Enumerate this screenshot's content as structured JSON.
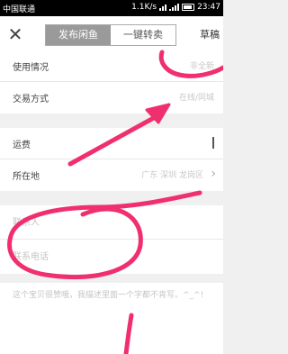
{
  "status_bar": {
    "carrier": "中国联通",
    "network_speed": "1.1K/s",
    "time": "23:47"
  },
  "toolbar": {
    "close_icon": "close-icon",
    "tabs": [
      {
        "label": "发布闲鱼",
        "active": true
      },
      {
        "label": "一键转卖",
        "active": false
      }
    ],
    "draft_label": "草稿"
  },
  "form": {
    "condition": {
      "label": "使用情况",
      "value": "非全新"
    },
    "trade_method": {
      "label": "交易方式",
      "value": "在线/同城"
    },
    "shipping": {
      "label": "运费"
    },
    "location": {
      "label": "所在地",
      "value": "广东 深圳 龙岗区"
    },
    "contact_person": {
      "placeholder": "联系人"
    },
    "contact_phone": {
      "placeholder": "联系电话"
    },
    "description": {
      "placeholder": "这个宝贝很赞哦，我描述里面一个字都不肯写。^_^!"
    }
  },
  "colors": {
    "annotation": "#f0306e",
    "active_tab": "#9a9a9a"
  }
}
